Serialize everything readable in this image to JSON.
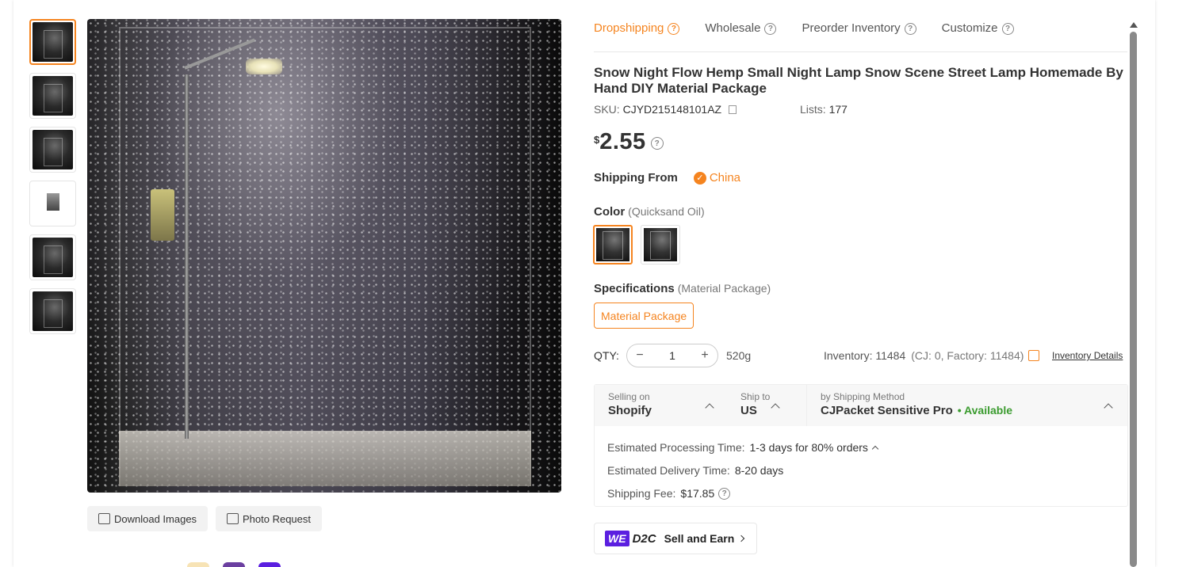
{
  "tabs": [
    {
      "label": "Dropshipping"
    },
    {
      "label": "Wholesale"
    },
    {
      "label": "Preorder Inventory"
    },
    {
      "label": "Customize"
    }
  ],
  "product": {
    "title": "Snow Night Flow Hemp Small Night Lamp Snow Scene Street Lamp Homemade By Hand DIY Material Package",
    "sku_label": "SKU:",
    "sku": "CJYD215148101AZ",
    "lists_label": "Lists:",
    "lists": "177",
    "currency": "$",
    "price": "2.55"
  },
  "shipping_from": {
    "label": "Shipping From",
    "country": "China"
  },
  "color": {
    "label": "Color",
    "selected": "(Quicksand Oil)"
  },
  "specifications": {
    "label": "Specifications",
    "selected": "(Material Package)",
    "option": "Material Package"
  },
  "qty": {
    "label": "QTY:",
    "value": "1",
    "minus": "−",
    "plus": "+",
    "weight": "520g"
  },
  "inventory": {
    "text": "Inventory: 11484",
    "sub": "(CJ: 0, Factory: 11484)",
    "link": "Inventory Details"
  },
  "ship": {
    "selling_on_label": "Selling on",
    "selling_on": "Shopify",
    "ship_to_label": "Ship to",
    "ship_to": "US",
    "method_label": "by Shipping Method",
    "method": "CJPacket Sensitive Pro",
    "availability": "• Available",
    "processing_label": "Estimated Processing Time:",
    "processing": "1-3 days for 80% orders",
    "delivery_label": "Estimated Delivery Time:",
    "delivery": "8-20 days",
    "fee_label": "Shipping Fee:",
    "fee": "$17.85"
  },
  "image_actions": {
    "download": "Download Images",
    "photo": "Photo Request"
  },
  "d2c": {
    "we": "WE",
    "d2c": "D2C",
    "sell": "Sell and Earn"
  },
  "colors": {
    "accent": "#f5841f",
    "available": "#3a9b2e",
    "d2c": "#5b1fe0"
  }
}
